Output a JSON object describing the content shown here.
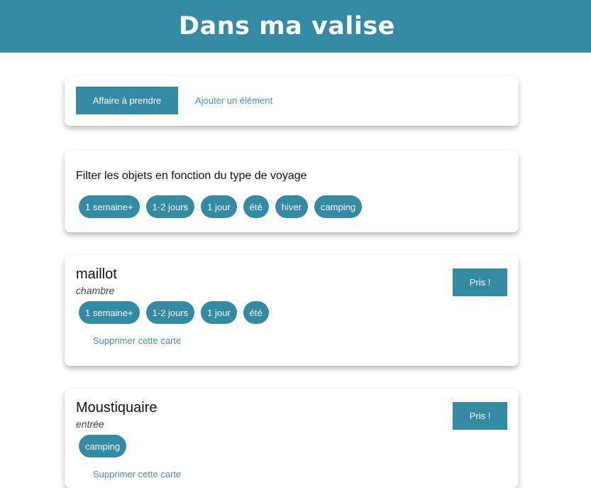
{
  "header": {
    "title": "Dans ma valise"
  },
  "actions": {
    "primary_label": "Affaire à prendre",
    "add_link_label": "Ajouter un élément"
  },
  "filter": {
    "title": "Filter les objets en fonction du type de voyage",
    "tags": [
      "1 semaine+",
      "1-2 jours",
      "1 jour",
      "été",
      "hiver",
      "camping"
    ]
  },
  "items": [
    {
      "name": "maillot",
      "room": "chambre",
      "tags": [
        "1 semaine+",
        "1-2 jours",
        "1 jour",
        "été"
      ],
      "taken_label": "Pris !",
      "delete_label": "Supprimer cette carte"
    },
    {
      "name": "Moustiquaire",
      "room": "entrée",
      "tags": [
        "camping"
      ],
      "taken_label": "Pris !",
      "delete_label": "Supprimer cette carte"
    }
  ],
  "colors": {
    "accent": "#338ba3",
    "link": "#4a93ad"
  }
}
